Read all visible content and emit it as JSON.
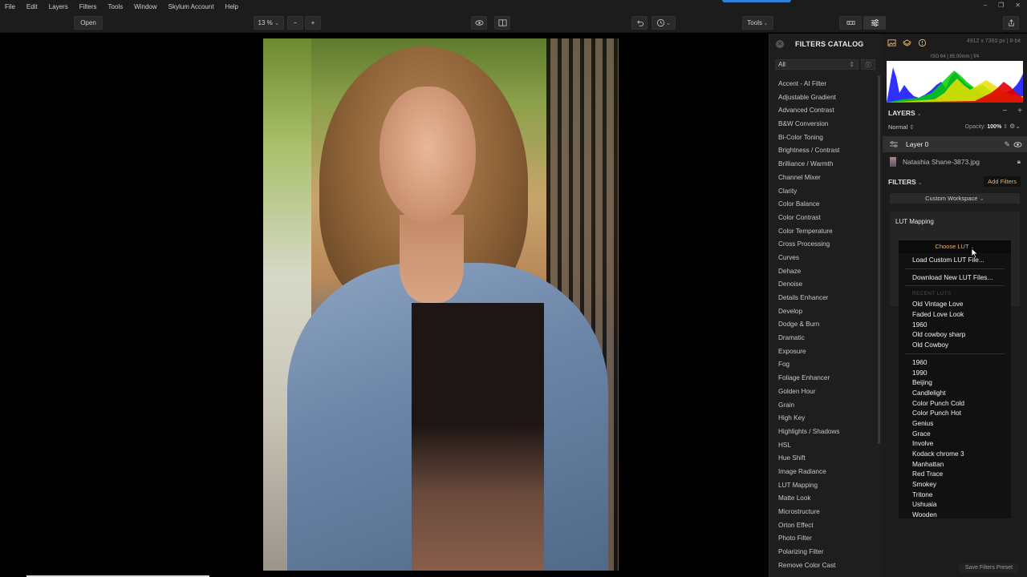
{
  "menu": [
    "File",
    "Edit",
    "Layers",
    "Filters",
    "Tools",
    "Window",
    "Skylum Account",
    "Help"
  ],
  "toolbar": {
    "open_label": "Open",
    "zoom": "13 %",
    "tools_label": "Tools"
  },
  "catalog": {
    "title": "FILTERS CATALOG",
    "filter_value": "All",
    "items": [
      "Accent - AI Filter",
      "Adjustable Gradient",
      "Advanced Contrast",
      "B&W Conversion",
      "Bi-Color Toning",
      "Brightness / Contrast",
      "Brilliance / Warmth",
      "Channel Mixer",
      "Clarity",
      "Color Balance",
      "Color Contrast",
      "Color Temperature",
      "Cross Processing",
      "Curves",
      "Dehaze",
      "Denoise",
      "Details Enhancer",
      "Develop",
      "Dodge & Burn",
      "Dramatic",
      "Exposure",
      "Fog",
      "Foliage Enhancer",
      "Golden Hour",
      "Grain",
      "High Key",
      "Highlights / Shadows",
      "HSL",
      "Hue Shift",
      "Image Radiance",
      "LUT Mapping",
      "Matte Look",
      "Microstructure",
      "Orton Effect",
      "Photo Filter",
      "Polarizing Filter",
      "Remove Color Cast"
    ]
  },
  "info": {
    "dimensions": "4912 x 7360 px  |  8-bit",
    "exif": "ISO 64  |  85.00mm  |  f/4"
  },
  "layers": {
    "title": "LAYERS",
    "blend_mode": "Normal",
    "opacity_label": "Opacity:",
    "opacity_value": "100%",
    "layer_name": "Layer 0",
    "file_name": "Natashia Shane-3873.jpg"
  },
  "filters": {
    "title": "FILTERS",
    "add_label": "Add Filters",
    "workspace": "Custom Workspace",
    "lut_title": "LUT Mapping"
  },
  "lut_dropdown": {
    "header": "Choose LUT",
    "load_custom": "Load Custom LUT File...",
    "download": "Download New LUT Files...",
    "recent_title": "RECENT LUTS",
    "recent": [
      "Old Vintage Love",
      "Faded Love Look",
      "1960",
      "Old cowboy sharp",
      "Old Cowboy"
    ],
    "all": [
      "1960",
      "1990",
      "Beijing",
      "Candlelight",
      "Color Punch Cold",
      "Color Punch Hot",
      "Genius",
      "Grace",
      "Involve",
      "Kodack chrome 3",
      "Manhattan",
      "Red Trace",
      "Smokey",
      "Tritone",
      "Ushuaia",
      "Wooden"
    ]
  },
  "footer": {
    "save_preset": "Save Filters Preset"
  },
  "colors": {
    "accent_orange": "#f2b46a",
    "panel_bg": "#1c1c1c",
    "selected_layer": "#303030"
  }
}
